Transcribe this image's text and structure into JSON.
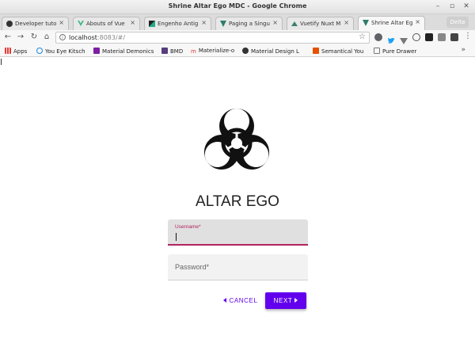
{
  "window": {
    "title": "Shrine Altar Ego MDC - Google Chrome"
  },
  "tabs": [
    {
      "label": "Developer tuto",
      "icon": "github-icon"
    },
    {
      "label": "Abouts of Vue",
      "icon": "vue-icon"
    },
    {
      "label": "Engenho Antig",
      "icon": "page-icon"
    },
    {
      "label": "Paging a Singu",
      "icon": "vuetify-icon"
    },
    {
      "label": "Vuetify Nuxt M",
      "icon": "nuxt-icon"
    },
    {
      "label": "Shrine Altar Eg",
      "icon": "vuetify-icon",
      "active": true
    }
  ],
  "profile": {
    "label": "Delta"
  },
  "address_bar": {
    "host": "localhost",
    "rest": ":8083/#/"
  },
  "bookmarks": [
    {
      "label": "Apps",
      "icon": "apps-grid-icon"
    },
    {
      "label": "You Eye Kitsch",
      "icon": "refresh-icon"
    },
    {
      "label": "Material Demonics",
      "icon": "material-icon"
    },
    {
      "label": "BMD",
      "icon": "bootstrap-icon"
    },
    {
      "label": "Materialize-o",
      "icon": "materialize-icon"
    },
    {
      "label": "Material Design L",
      "icon": "mdl-icon"
    },
    {
      "label": "Semantical You",
      "icon": "semantic-icon"
    },
    {
      "label": "Pure Drawer",
      "icon": "doc-icon"
    }
  ],
  "app": {
    "brand": "ALTAR EGO",
    "username": {
      "label": "Username*",
      "value": ""
    },
    "password": {
      "label": "Password*",
      "value": ""
    },
    "cancel_label": "CANCEL",
    "next_label": "NEXT"
  },
  "colors": {
    "accent": "#6200ee",
    "field_focus": "#b0235f"
  }
}
